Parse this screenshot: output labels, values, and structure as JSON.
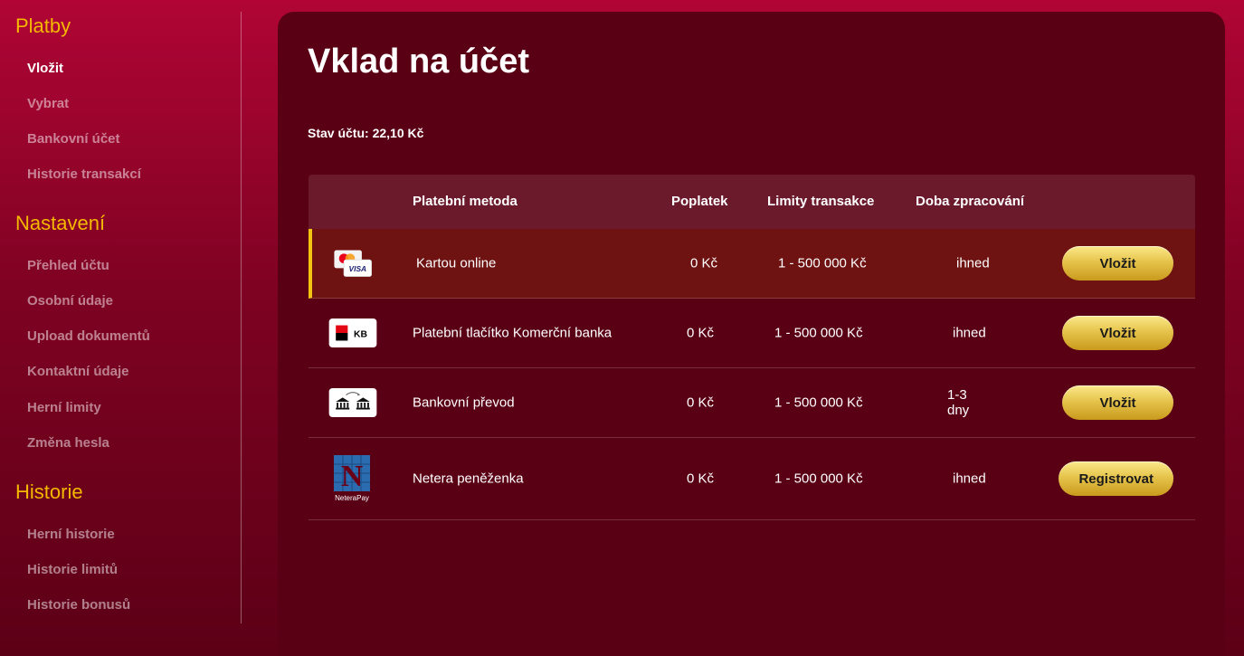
{
  "sidebar": {
    "sections": [
      {
        "heading": "Platby",
        "items": [
          "Vložit",
          "Vybrat",
          "Bankovní účet",
          "Historie transakcí"
        ]
      },
      {
        "heading": "Nastavení",
        "items": [
          "Přehled účtu",
          "Osobní údaje",
          "Upload dokumentů",
          "Kontaktní údaje",
          "Herní limity",
          "Změna hesla"
        ]
      },
      {
        "heading": "Historie",
        "items": [
          "Herní historie",
          "Historie limitů",
          "Historie bonusů"
        ]
      }
    ]
  },
  "main": {
    "title": "Vklad na účet",
    "balance_label": "Stav účtu:",
    "balance_value": "22,10 Kč",
    "columns": [
      "Platební metoda",
      "Poplatek",
      "Limity transakce",
      "Doba zpracování"
    ],
    "rows": [
      {
        "method": "Kartou online",
        "fee": "0 Kč",
        "limit": "1 - 500 000 Kč",
        "time": "ihned",
        "action": "Vložit",
        "logo": "card-logo"
      },
      {
        "method": "Platební tlačítko Komerční banka",
        "fee": "0 Kč",
        "limit": "1 - 500 000 Kč",
        "time": "ihned",
        "action": "Vložit",
        "logo": "kb-logo"
      },
      {
        "method": "Bankovní převod",
        "fee": "0 Kč",
        "limit": "1 - 500 000 Kč",
        "time": "1-3 dny",
        "action": "Vložit",
        "logo": "bank-transfer-logo"
      },
      {
        "method": "Netera peněženka",
        "fee": "0 Kč",
        "limit": "1 - 500 000 Kč",
        "time": "ihned",
        "action": "Registrovat",
        "logo": "netera-logo"
      }
    ],
    "logo_text": {
      "visa": "VISA",
      "kb": "KB",
      "netera": "NeteraPay",
      "netera_letter": "N"
    }
  },
  "colors": {
    "accent": "#f5b800",
    "panel": "#5a0015",
    "active_row": "#6e1212"
  }
}
